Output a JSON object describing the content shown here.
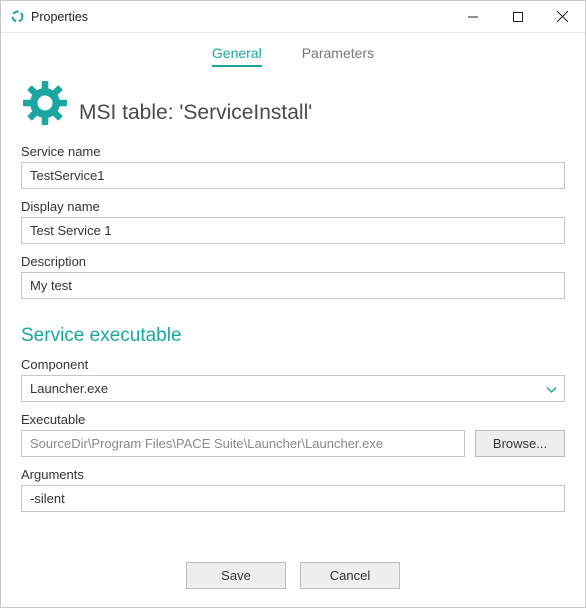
{
  "window": {
    "title": "Properties"
  },
  "tabs": {
    "general": "General",
    "parameters": "Parameters"
  },
  "header": {
    "title": "MSI table: 'ServiceInstall'"
  },
  "fields": {
    "service_name": {
      "label": "Service name",
      "value": "TestService1"
    },
    "display_name": {
      "label": "Display name",
      "value": "Test Service 1"
    },
    "description": {
      "label": "Description",
      "value": "My test"
    }
  },
  "section": {
    "title": "Service executable"
  },
  "component": {
    "label": "Component",
    "value": "Launcher.exe"
  },
  "executable": {
    "label": "Executable",
    "value": "SourceDir\\Program Files\\PACE Suite\\Launcher\\Launcher.exe",
    "browse": "Browse..."
  },
  "arguments": {
    "label": "Arguments",
    "value": "-silent"
  },
  "buttons": {
    "save": "Save",
    "cancel": "Cancel"
  }
}
